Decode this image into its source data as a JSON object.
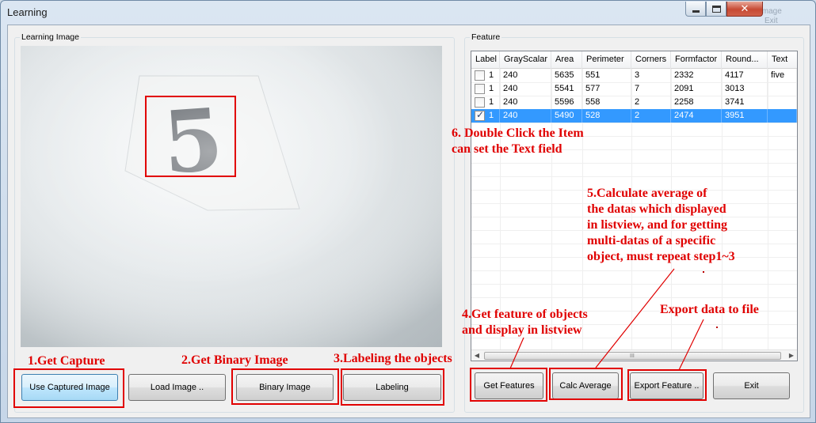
{
  "window": {
    "title": "Learning",
    "close_glyph": "✕",
    "background_text_1": "Image",
    "background_text_2": "Exit"
  },
  "learning_image": {
    "group_label": "Learning Image",
    "digit": "5"
  },
  "feature": {
    "group_label": "Feature",
    "columns": [
      "Label",
      "GrayScalar",
      "Area",
      "Perimeter",
      "Corners",
      "Formfactor",
      "Round...",
      "Text"
    ],
    "rows": [
      {
        "checked": false,
        "selected": false,
        "cells": [
          "1",
          "240",
          "5635",
          "551",
          "3",
          "2332",
          "4117",
          "five"
        ]
      },
      {
        "checked": false,
        "selected": false,
        "cells": [
          "1",
          "240",
          "5541",
          "577",
          "7",
          "2091",
          "3013",
          ""
        ]
      },
      {
        "checked": false,
        "selected": false,
        "cells": [
          "1",
          "240",
          "5596",
          "558",
          "2",
          "2258",
          "3741",
          ""
        ]
      },
      {
        "checked": true,
        "selected": true,
        "cells": [
          "1",
          "240",
          "5490",
          "528",
          "2",
          "2474",
          "3951",
          ""
        ]
      }
    ],
    "scroll_grip": "III"
  },
  "buttons": {
    "use_captured": "Use Captured Image",
    "load_image": "Load Image ..",
    "binary_image": "Binary Image",
    "labeling": "Labeling",
    "get_features": "Get Features",
    "calc_average": "Calc Average",
    "export_feature": "Export Feature ..",
    "exit": "Exit"
  },
  "annotations": {
    "step1": "1.Get Capture",
    "step2": "2.Get Binary Image",
    "step3": "3.Labeling the objects",
    "step4": [
      "4.Get feature of objects",
      "and display in listview"
    ],
    "step5": [
      "5.Calculate average of",
      "the datas which displayed",
      "in listview, and for getting",
      "multi-datas of a specific",
      "object, must repeat step1~3"
    ],
    "step6": [
      "6. Double Click the Item",
      "can set the Text field"
    ],
    "export": "Export data to file"
  },
  "colors": {
    "annotation_red": "#e00000",
    "selection_blue": "#3399ff"
  }
}
